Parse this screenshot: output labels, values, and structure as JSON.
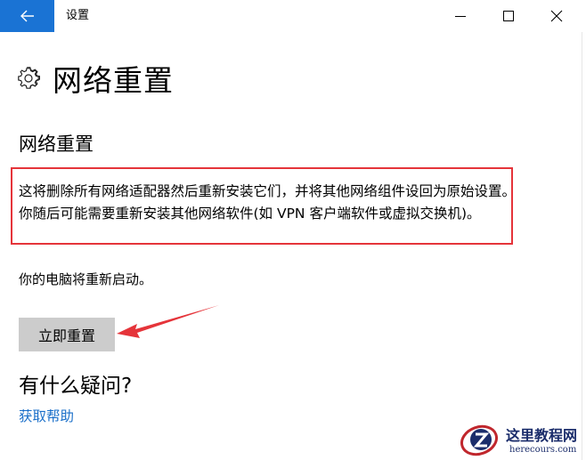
{
  "window": {
    "title": "设置"
  },
  "icons": {
    "back": "back-arrow-icon",
    "minimize": "minimize-icon",
    "maximize": "maximize-icon",
    "close": "close-icon",
    "settings": "gear-icon"
  },
  "colors": {
    "accent": "#1a73d4",
    "link": "#1a6fc9",
    "highlight": "#e5343a",
    "button_bg": "#cccccc"
  },
  "page": {
    "title": "网络重置",
    "section_title": "网络重置",
    "description": "这将删除所有网络适配器然后重新安装它们，并将其他网络组件设回为原始设置。你随后可能需要重新安装其他网络软件(如 VPN 客户端软件或虚拟交换机)。",
    "restart_note": "你的电脑将重新启动。",
    "reset_button": "立即重置",
    "faq_title": "有什么疑问?",
    "help_link": "获取帮助"
  },
  "watermark": {
    "title": "这里教程网",
    "url": "herecours.com"
  }
}
